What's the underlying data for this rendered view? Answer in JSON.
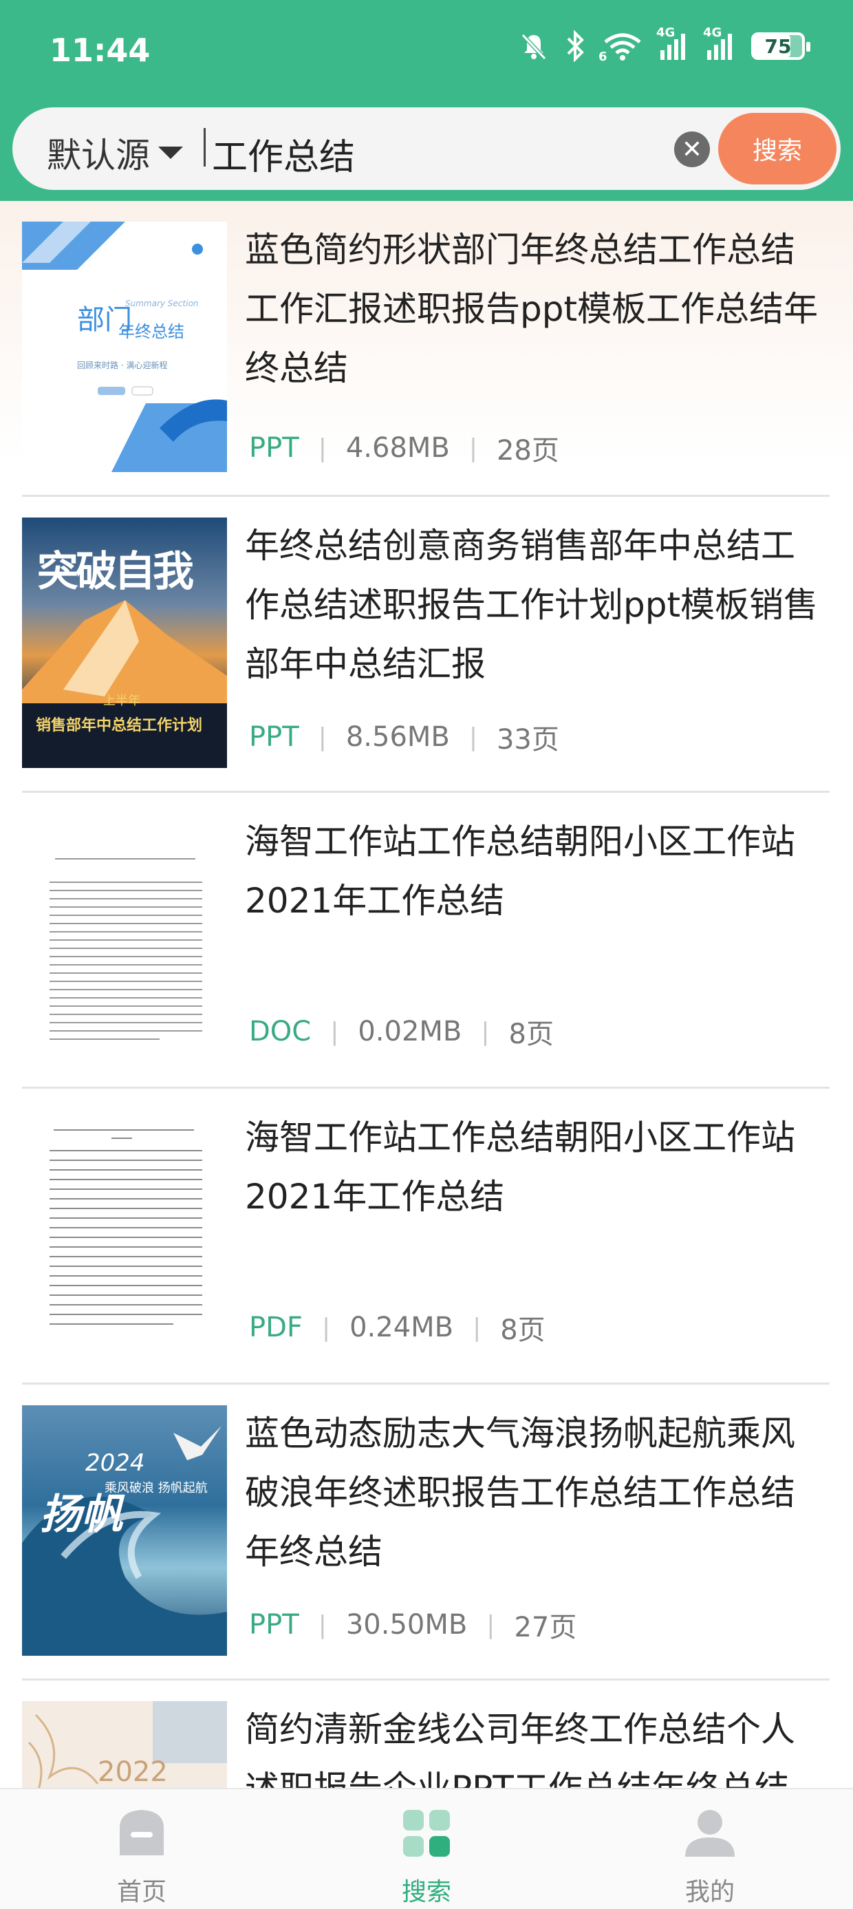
{
  "status_bar": {
    "time": "11:44",
    "battery": "75",
    "signal_1": "4G",
    "signal_2": "4G",
    "wifi_badge": "6"
  },
  "search": {
    "source_label": "默认源",
    "query": "工作总结",
    "button_label": "搜索"
  },
  "results": [
    {
      "title": "蓝色简约形状部门年终总结工作总结工作汇报述职报告ppt模板工作总结年终总结",
      "type": "PPT",
      "size": "4.68MB",
      "pages": "28页",
      "thumb": {
        "heading": "部门",
        "subheading": "年终总结",
        "en": "Summary Section",
        "line": "回顾来时路 · 满心迎新程"
      }
    },
    {
      "title": "年终总结创意商务销售部年中总结工作总结述职报告工作计划ppt模板销售部年中总结汇报",
      "type": "PPT",
      "size": "8.56MB",
      "pages": "33页",
      "thumb": {
        "heading": "突破自我",
        "tag": "上半年",
        "caption": "销售部年中总结工作计划"
      }
    },
    {
      "title": "海智工作站工作总结朝阳小区工作站2021年工作总结",
      "type": "DOC",
      "size": "0.02MB",
      "pages": "8页"
    },
    {
      "title": "海智工作站工作总结朝阳小区工作站2021年工作总结",
      "type": "PDF",
      "size": "0.24MB",
      "pages": "8页"
    },
    {
      "title": "蓝色动态励志大气海浪扬帆起航乘风破浪年终述职报告工作总结工作总结年终总结",
      "type": "PPT",
      "size": "30.50MB",
      "pages": "27页",
      "thumb": {
        "heading": "扬帆",
        "year": "2024",
        "caption": "乘风破浪 扬帆起航"
      }
    },
    {
      "title": "简约清新金线公司年终工作总结个人述职报告企业PPT工作总结年终总结",
      "type": "PPT",
      "size": "",
      "pages": "",
      "thumb": {
        "year": "2022"
      }
    }
  ],
  "tabbar": {
    "home": "首页",
    "search": "搜索",
    "mine": "我的"
  },
  "colors": {
    "header": "#3cb98a",
    "search_button": "#f5855c",
    "accent_green": "#3aaa84"
  }
}
